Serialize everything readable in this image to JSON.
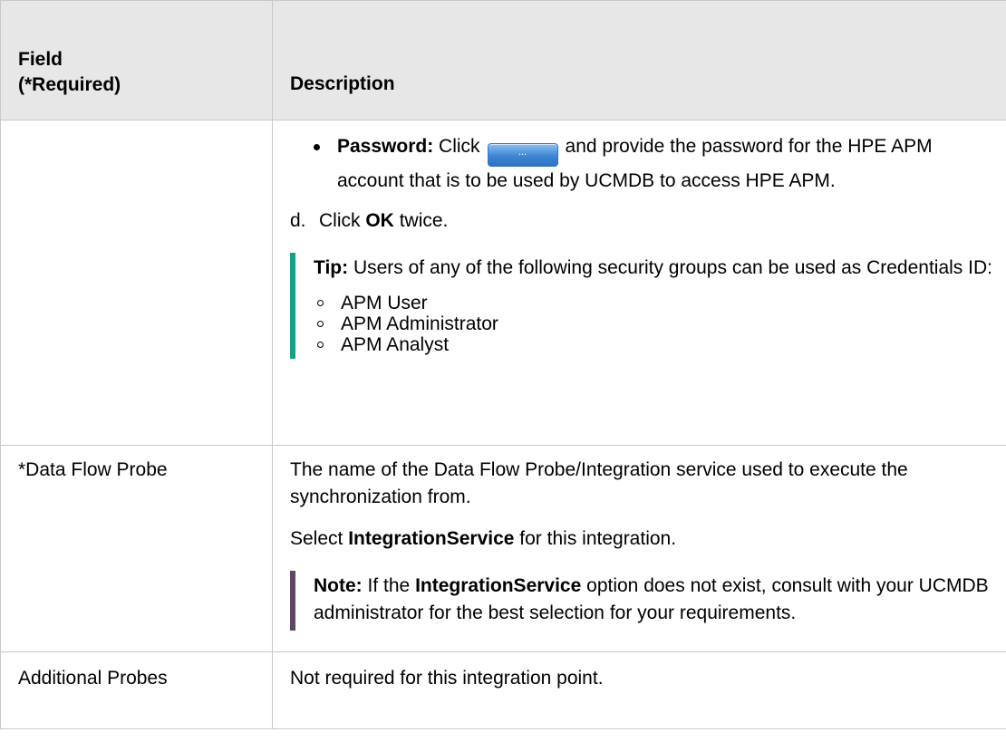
{
  "header": {
    "field_line1": "Field",
    "field_line2": "(*Required)",
    "description": "Description"
  },
  "credentials_row": {
    "field": "",
    "password_label": "Password:",
    "password_pre": "Click",
    "button_label": "...",
    "password_post": "and provide the password for the HPE APM account that is to be used by UCMDB to access HPE APM.",
    "step_letter": "d.",
    "step_pre": "Click",
    "step_bold": "OK",
    "step_post": "twice.",
    "tip_label": "Tip:",
    "tip_text": "Users of any of the following security groups can be used as Credentials ID:",
    "tip_items": [
      "APM User",
      "APM Administrator",
      "APM Analyst"
    ]
  },
  "probe_row": {
    "field": "*Data Flow Probe",
    "desc1": "The name of the Data Flow Probe/Integration service used to execute the synchronization from.",
    "desc2_pre": "Select",
    "desc2_bold": "IntegrationService",
    "desc2_post": "for this integration.",
    "note_label": "Note:",
    "note_pre": "If the",
    "note_bold": "IntegrationService",
    "note_post": "option does not exist, consult with your UCMDB administrator for the best selection for your requirements."
  },
  "additional_row": {
    "field": "Additional Probes",
    "desc": "Not required for this integration point."
  },
  "colors": {
    "tip_accent": "#16a085",
    "note_accent": "#614767",
    "header_bg": "#e7e7e7",
    "border": "#c8c8c8"
  }
}
